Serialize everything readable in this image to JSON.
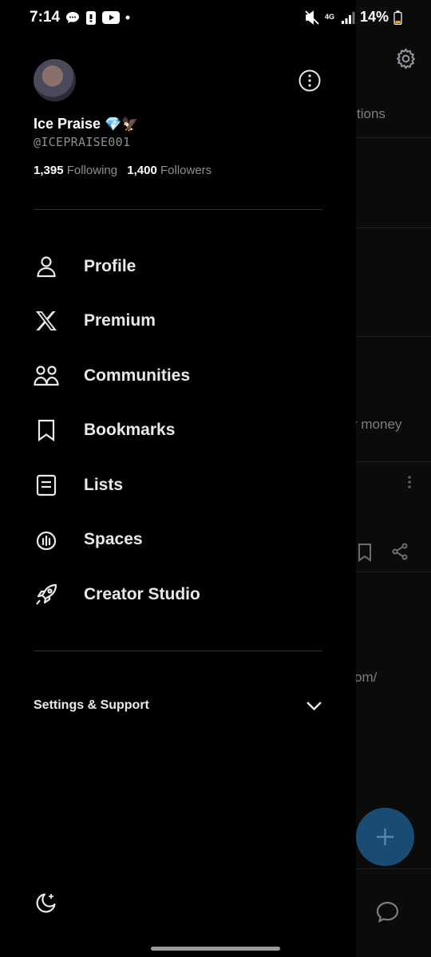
{
  "status_bar": {
    "time": "7:14",
    "network": "4G",
    "battery": "14%"
  },
  "background": {
    "tab_fragment": "tions",
    "snippet_money": "r money",
    "snippet_url": "om/"
  },
  "profile": {
    "display_name": "Ice Praise",
    "name_emoji": "💎🦅",
    "handle": "@ICEPRAISE001",
    "following_count": "1,395",
    "following_label": "Following",
    "followers_count": "1,400",
    "followers_label": "Followers"
  },
  "menu": [
    {
      "label": "Profile",
      "icon": "person-icon"
    },
    {
      "label": "Premium",
      "icon": "x-logo-icon"
    },
    {
      "label": "Communities",
      "icon": "people-icon"
    },
    {
      "label": "Bookmarks",
      "icon": "bookmark-icon"
    },
    {
      "label": "Lists",
      "icon": "list-icon"
    },
    {
      "label": "Spaces",
      "icon": "spaces-icon"
    },
    {
      "label": "Creator Studio",
      "icon": "rocket-icon"
    }
  ],
  "settings_support": {
    "label": "Settings & Support"
  },
  "colors": {
    "background": "#000000",
    "text": "#e7e9ea",
    "muted": "#8b8f93",
    "fab": "#1a4c73"
  }
}
